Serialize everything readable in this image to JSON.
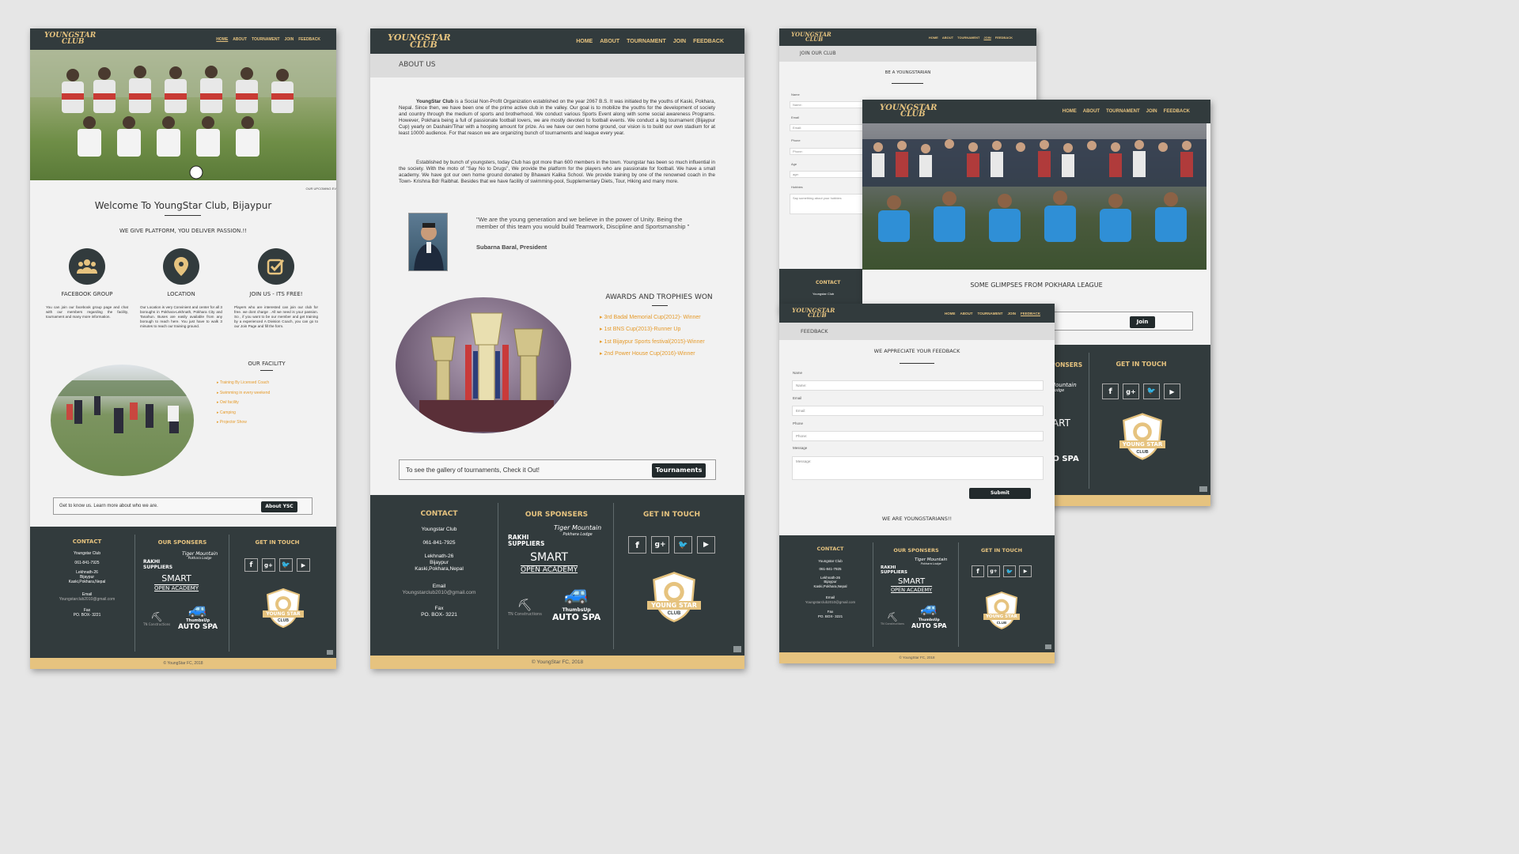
{
  "logo": {
    "line1": "YOUNGSTAR",
    "line2": "CLUB"
  },
  "nav": {
    "home": "HOME",
    "about": "ABOUT",
    "tournament": "TOURNAMENT",
    "join": "JOIN",
    "feedback": "FEEDBACK"
  },
  "home": {
    "ticker": "OUR UPCOMING EV",
    "welcome": "Welcome To YoungStar Club, Bijaypur",
    "tagline": "WE GIVE PLATFORM, YOU DELIVER PASSION.!!",
    "features": [
      {
        "title": "FACEBOOK GROUP",
        "text": "You can join our facebook group page and chat with our members regarding the facility, tournament and many more information."
      },
      {
        "title": "LOCATION",
        "text": "Our Location is very Convinient and center for all 3 boroughs in Pokhara-Lekhnath, Pokhara City and Tanahun. Buses are easily available from any borough to reach here. You just have to walk 3 minutes to reach our training ground."
      },
      {
        "title": "JOIN US - ITS FREE!",
        "text": "Players who are interested can join our club for free. we dont charge . All we need is your passion. So , if you want to be our member and get training by a experienced A Division Coach, you can go to our Join Page and fill the form."
      }
    ],
    "facility_title": "OUR FACILITY",
    "facility": [
      "Training By Licensed Coach",
      "Swimming in every weekend",
      "Owl facility",
      "Camping",
      "Projector Show"
    ],
    "about_text": "Get to know us. Learn more about who we are.",
    "about_btn": "About YSC"
  },
  "about": {
    "title": "ABOUT US",
    "p1_bold": "YoungStar Club",
    "p1": " is a Social Non-Profit Organization established on the year 2067 B.S. It was initiated by the youths of Kaski, Pokhara, Nepal. Since then, we have been one of the prime active club in the valley. Our goal is to mobilize the youths for the development of society and country through the medium of sports and brotherhood. We conduct various Sports Event along with some social awareness Programs. However, Pokhara being a full of passionate football lovers, we are mostly devoted to football events. We conduct a big tournament (Bijaypur Cup) yearly on Dashain/Tihar with a hooping amount for prize. As we have our own home ground, our vision is to build our own stadium for at least 10000 audience. For that reason we are organizing bunch of tournaments and league every year.",
    "p2": "Established by bunch of youngsters, today Club has got more than 600 members in the town. Youngstar has been so much influential in the society. With the moto of \"Say No to Drugs\", We provide the platform for the players who are passionate for football. We have a small academy. We have got our own home ground donated by Bhawani Kalika School. We provide training by one of the renowned coach in the Town- Krishna Bdr Raibhat. Besides that we have facility of swimming-pool, Supplementary Diets, Tour, Hiking and many more.",
    "quote": "\"We are the young generation and we believe in the power of Unity. Being the member of this team you would build Teamwork, Discipline and Sportsmanship \"",
    "author": "Subarna Baral, President",
    "awards_title": "AWARDS AND TROPHIES WON",
    "awards": [
      "3rd Badal Memorial Cup(2012)- Winner",
      "1st BNS Cup(2013)-Runner Up",
      "1st Bijaypur Sports festival(2015)-Winner",
      "2nd Power House Cup(2016)-Winner"
    ],
    "gallery_text": "To see the gallery of tournaments, Check it Out!",
    "gallery_btn": "Tournaments"
  },
  "join": {
    "title": "JOIN OUR CLUB",
    "subtitle": "BE A YOUNGSTARIAN",
    "fields": [
      {
        "label": "Name",
        "placeholder": "Name:"
      },
      {
        "label": "Email",
        "placeholder": "Email:"
      },
      {
        "label": "Phone",
        "placeholder": "Phone:"
      },
      {
        "label": "Age",
        "placeholder": "age:"
      },
      {
        "label": "Hobbies",
        "placeholder": "Say something about your hobbies"
      }
    ]
  },
  "tournament": {
    "glimpses": "SOME GLIMPSES FROM POKHARA LEAGUE",
    "join_btn": "Join"
  },
  "feedback": {
    "title": "FEEDBACK",
    "subtitle": "WE APPRECIATE YOUR FEEDBACK",
    "fields": [
      {
        "label": "Name",
        "placeholder": "Name:"
      },
      {
        "label": "Email",
        "placeholder": "Email:"
      },
      {
        "label": "Phone",
        "placeholder": "Phone:"
      },
      {
        "label": "Message",
        "placeholder": "Message:"
      }
    ],
    "submit": "Submit",
    "closing": "WE ARE YOUNGSTARIANS!!"
  },
  "footer": {
    "contact_title": "CONTACT",
    "org": "Youngstar Club",
    "phone": "061-841-7925",
    "addr1": "Lekhnath-26",
    "addr2": "Bijaypur",
    "addr3": "Kaski,Pokhara,Nepal",
    "email_label": "Email",
    "email": "Youngstarclub2010@gmail.com",
    "fax_label": "Fax",
    "fax": "PO. BOX- 3221",
    "sponsors_title": "OUR SPONSERS",
    "sponsors": {
      "rakhi1": "RAKHI",
      "rakhi2": "SUPPLIERS",
      "tiger1": "Tiger Mountain",
      "tiger2": "Pokhara Lodge",
      "smart1": "SMART",
      "smart2": "OPEN ACADEMY",
      "tn": "TN Constructions",
      "thumbs": "ThumbsUp",
      "auto": "AUTO SPA"
    },
    "touch_title": "GET IN TOUCH",
    "badge1": "YOUNG STAR",
    "badge2": "CLUB"
  },
  "copyright_home": "© YoungStar FC, 2018",
  "copyright_about": "© YoungStar FC, 2018",
  "copyright_feedback": "© YoungStar FC, 2018",
  "colors": {
    "dark": "#323b3d",
    "gold": "#e6c37f",
    "orange": "#e59a2a"
  }
}
